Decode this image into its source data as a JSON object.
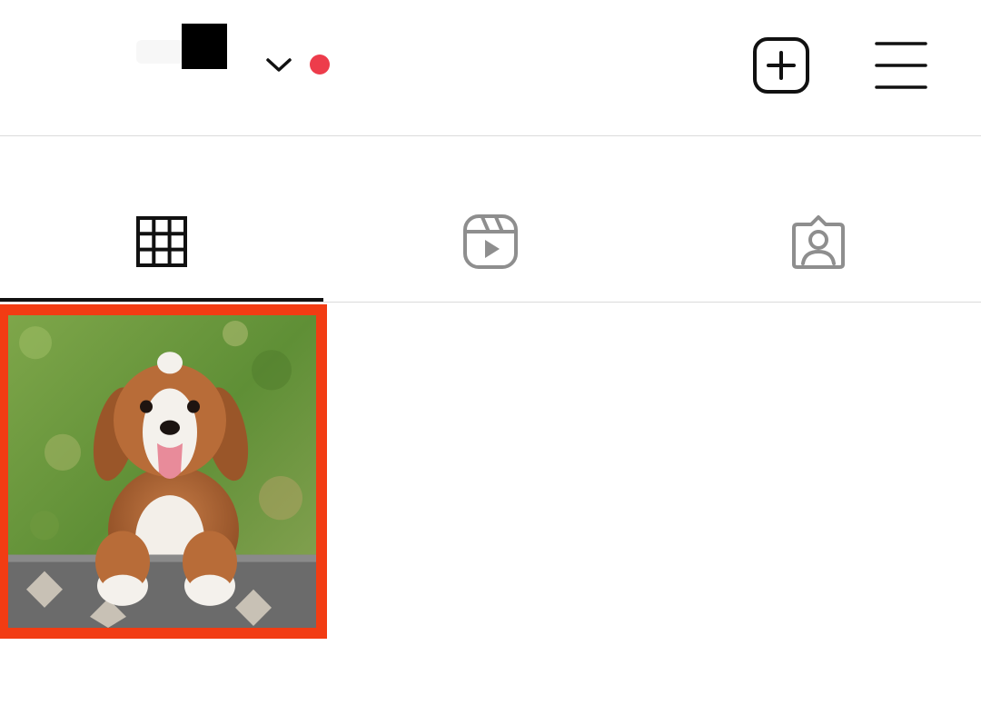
{
  "header": {
    "account_switcher_icon": "chevron-down-icon",
    "notification_color": "#ed3c4b",
    "new_post_icon": "add-square-icon",
    "menu_icon": "hamburger-menu-icon"
  },
  "tabs": [
    {
      "icon": "grid-icon",
      "active": true
    },
    {
      "icon": "reels-icon",
      "active": false
    },
    {
      "icon": "tagged-icon",
      "active": false
    }
  ],
  "posts": [
    {
      "image": "puppy-photo",
      "highlight_color": "#f23c13"
    }
  ],
  "colors": {
    "active": "#111111",
    "inactive": "#8e8e8e",
    "divider": "#dbdbdb"
  }
}
